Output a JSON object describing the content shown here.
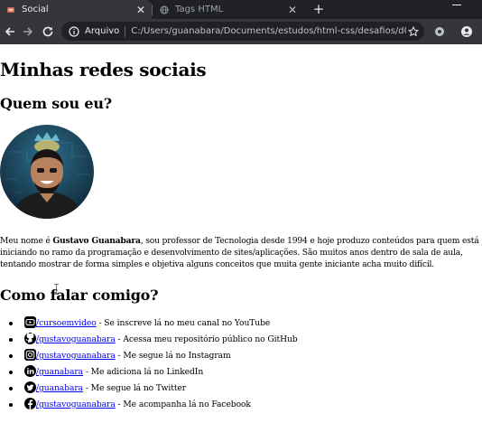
{
  "browser": {
    "tabs": [
      {
        "title": "Social",
        "active": true
      },
      {
        "title": "Tags HTML",
        "active": false
      }
    ],
    "new_tab_symbol": "+",
    "close_symbol": "✕",
    "address": {
      "scheme_label": "Arquivo",
      "url": "C:/Users/guanabara/Documents/estudos/html-css/desafios/d005/in..."
    }
  },
  "page": {
    "title": "Minhas redes sociais",
    "about_heading": "Quem sou eu?",
    "avatar_icon": "avatar-photo",
    "bio": {
      "intro": "Meu nome é ",
      "name": "Gustavo Guanabara",
      "rest": ", sou professor de Tecnologia desde 1994 e hoje produzo conteúdos para quem está iniciando no ramo da programação e desenvolvimento de sites/aplicações. São muitos anos dentro de sala de aula, tentando mostrar de forma simples e objetiva alguns conceitos que muita gente iniciante acha muito difícil."
    },
    "contact_heading": "Como falar comigo?",
    "social": [
      {
        "icon": "youtube-icon",
        "link": "/cursoemvideo",
        "desc": " - Se inscreve lá no meu canal no YouTube"
      },
      {
        "icon": "github-icon",
        "link": "/gustavoguanabara",
        "desc": " - Acessa meu repositório público no GitHub"
      },
      {
        "icon": "instagram-icon",
        "link": "/gustavoguanabara",
        "desc": " - Me segue lá no Instagram"
      },
      {
        "icon": "linkedin-icon",
        "link": "/guanabara",
        "desc": " - Me adiciona lá no LinkedIn"
      },
      {
        "icon": "twitter-icon",
        "link": "/guanabara",
        "desc": " - Me segue lá no Twitter"
      },
      {
        "icon": "facebook-icon",
        "link": "/gustavoguanabara",
        "desc": " - Me acompanha lá no Facebook"
      }
    ]
  },
  "colors": {
    "chrome_dark": "#202124",
    "chrome_tab": "#35363a",
    "link": "#0000ee"
  }
}
